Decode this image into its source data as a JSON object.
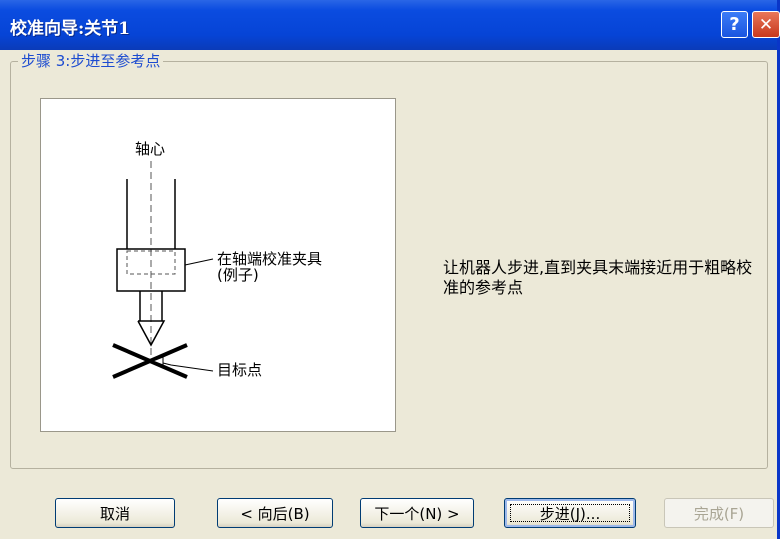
{
  "window": {
    "title": "校准向导:关节1",
    "help_label": "?",
    "close_label": "✕"
  },
  "step": {
    "title": "步骤 3:步进至参考点"
  },
  "diagram": {
    "axis_label": "轴心",
    "fixture_label_line1": "在轴端校准夹具",
    "fixture_label_line2": "(例子)",
    "target_label": "目标点"
  },
  "description": {
    "text": "让机器人步进,直到夹具末端接近用于粗略校准的参考点"
  },
  "buttons": {
    "cancel": "取消",
    "back": "< 向后(B)",
    "next": "下一个(N) >",
    "jog": "步进(J)...",
    "finish": "完成(F)"
  }
}
